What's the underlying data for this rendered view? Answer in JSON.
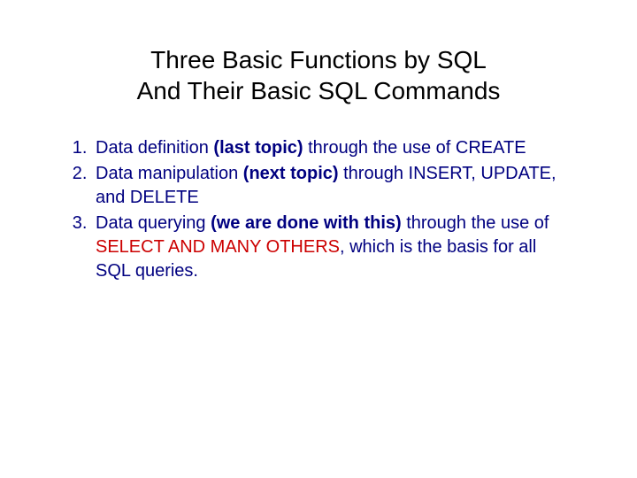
{
  "title_line1": "Three Basic Functions by SQL",
  "title_line2": "And Their Basic SQL Commands",
  "items": {
    "i1": {
      "pre": "Data definition ",
      "bold": "(last topic)",
      "post": " through the use of CREATE"
    },
    "i2": {
      "pre": "Data manipulation ",
      "bold": "(next topic)",
      "post": " through INSERT, UPDATE, and DELETE"
    },
    "i3": {
      "pre": "Data querying ",
      "bold": "(we are done with this)",
      "mid": " through the use of ",
      "red": "SELECT AND MANY OTHERS",
      "post": ", which is the basis for all SQL queries."
    }
  }
}
